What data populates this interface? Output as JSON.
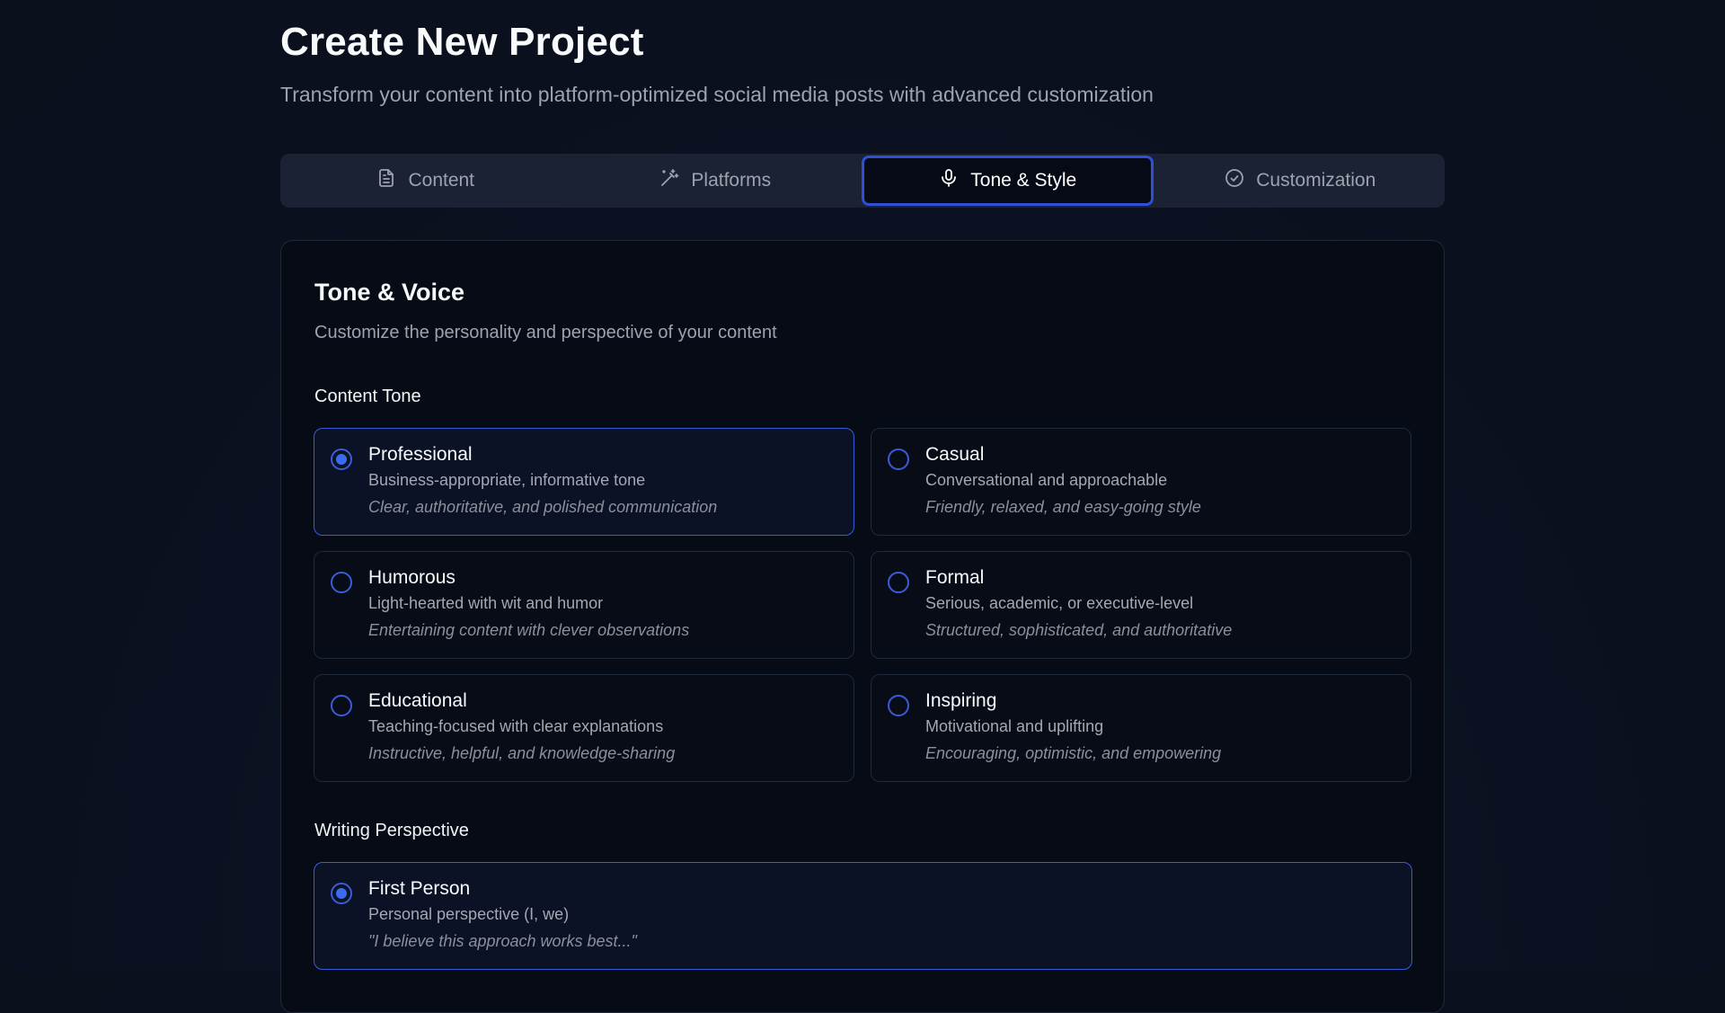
{
  "header": {
    "title": "Create New Project",
    "subtitle": "Transform your content into platform-optimized social media posts with advanced customization"
  },
  "tabs": [
    {
      "label": "Content",
      "icon": "document-icon",
      "active": false
    },
    {
      "label": "Platforms",
      "icon": "magic-wand-icon",
      "active": false
    },
    {
      "label": "Tone & Style",
      "icon": "microphone-icon",
      "active": true
    },
    {
      "label": "Customization",
      "icon": "check-circle-icon",
      "active": false
    }
  ],
  "card": {
    "title": "Tone & Voice",
    "subtitle": "Customize the personality and perspective of your content"
  },
  "content_tone": {
    "label": "Content Tone",
    "options": [
      {
        "title": "Professional",
        "description": "Business-appropriate, informative tone",
        "example": "Clear, authoritative, and polished communication",
        "selected": true
      },
      {
        "title": "Casual",
        "description": "Conversational and approachable",
        "example": "Friendly, relaxed, and easy-going style",
        "selected": false
      },
      {
        "title": "Humorous",
        "description": "Light-hearted with wit and humor",
        "example": "Entertaining content with clever observations",
        "selected": false
      },
      {
        "title": "Formal",
        "description": "Serious, academic, or executive-level",
        "example": "Structured, sophisticated, and authoritative",
        "selected": false
      },
      {
        "title": "Educational",
        "description": "Teaching-focused with clear explanations",
        "example": "Instructive, helpful, and knowledge-sharing",
        "selected": false
      },
      {
        "title": "Inspiring",
        "description": "Motivational and uplifting",
        "example": "Encouraging, optimistic, and empowering",
        "selected": false
      }
    ]
  },
  "writing_perspective": {
    "label": "Writing Perspective",
    "options": [
      {
        "title": "First Person",
        "description": "Personal perspective (I, we)",
        "example": "\"I believe this approach works best...\"",
        "selected": true
      }
    ]
  },
  "colors": {
    "accent": "#3b5bd8",
    "background": "#0b1120",
    "card": "#060b16"
  }
}
